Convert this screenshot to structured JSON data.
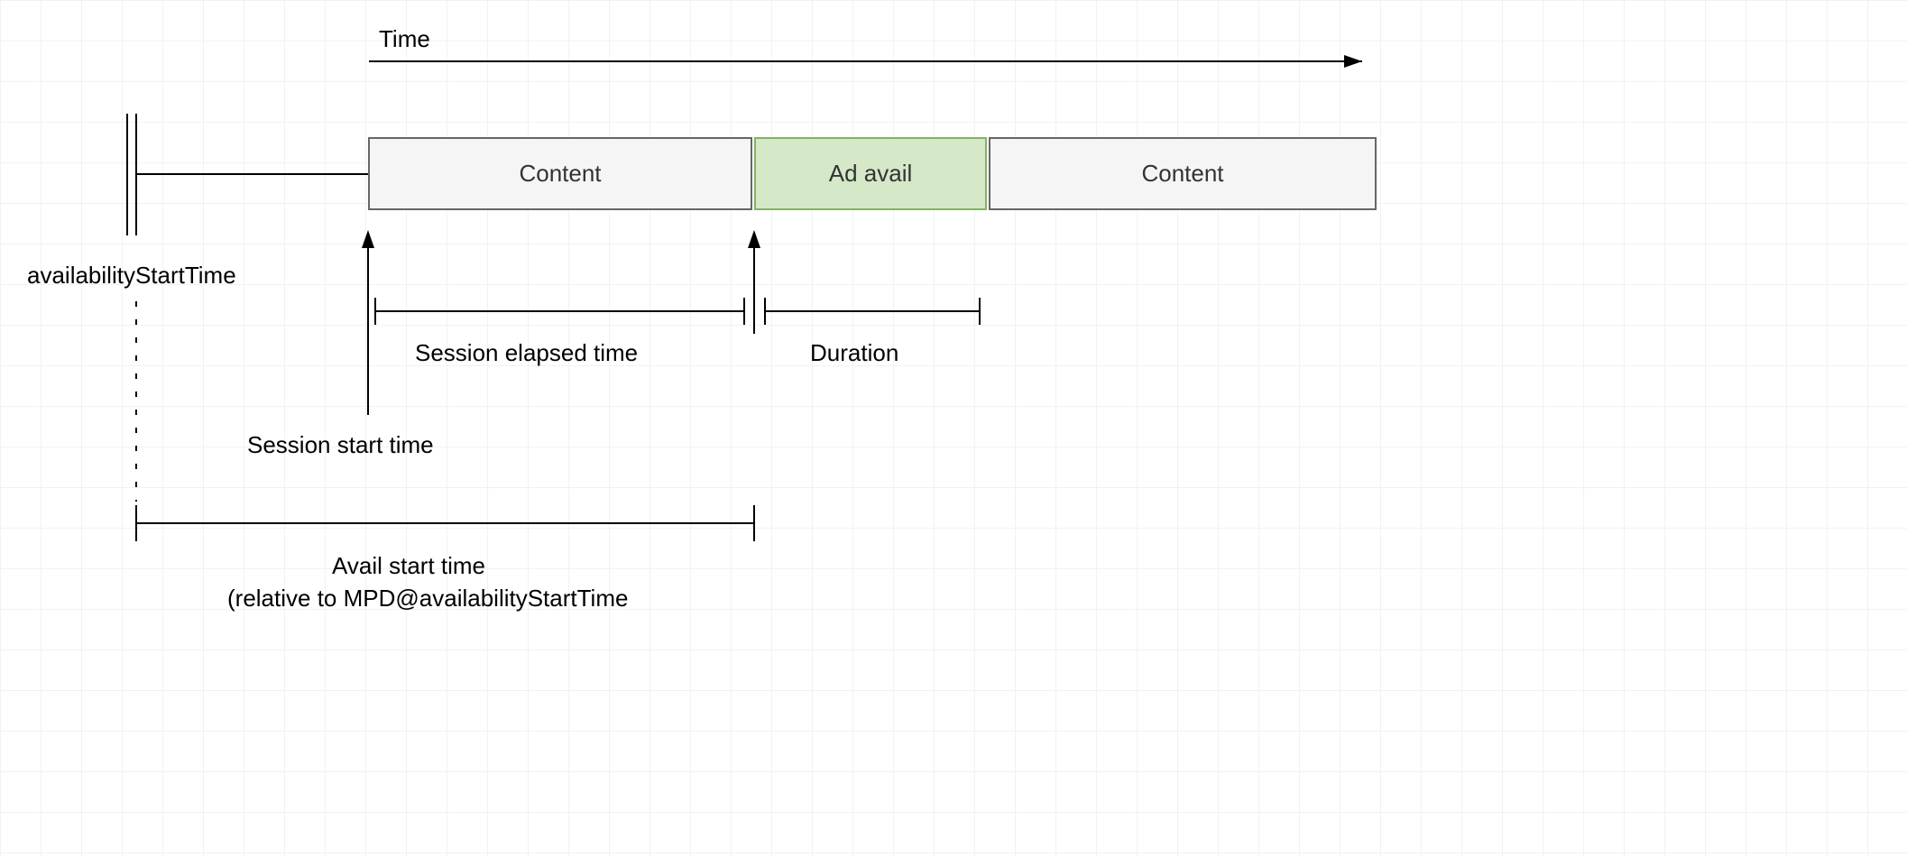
{
  "labels": {
    "time": "Time",
    "availabilityStartTime": "availabilityStartTime",
    "sessionElapsedTime": "Session elapsed time",
    "duration": "Duration",
    "sessionStartTime": "Session start time",
    "availStartTime1": "Avail start time",
    "availStartTime2": "(relative to MPD@availabilityStartTime"
  },
  "blocks": {
    "content1": "Content",
    "adAvail": "Ad avail",
    "content2": "Content"
  }
}
